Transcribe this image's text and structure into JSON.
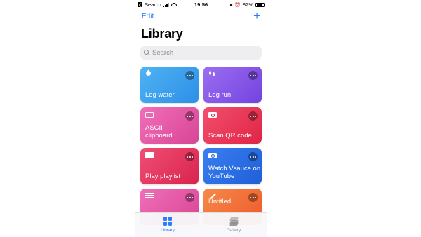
{
  "status_bar": {
    "carrier": "Search",
    "time": "19:56",
    "battery": "82%",
    "battery_level": 0.82
  },
  "nav": {
    "edit_label": "Edit",
    "add_label": "+"
  },
  "page": {
    "title": "Library"
  },
  "search": {
    "placeholder": "Search"
  },
  "shortcuts": [
    {
      "label": "Log water",
      "icon": "water-drop-icon",
      "color": "#2d8fe6"
    },
    {
      "label": "Log run",
      "icon": "footprints-icon",
      "color": "#7443e0"
    },
    {
      "label": "ASCII clipboard",
      "icon": "keyboard-icon",
      "color": "#d94596"
    },
    {
      "label": "Scan QR code",
      "icon": "camera-icon",
      "color": "#e02545"
    },
    {
      "label": "Play playlist",
      "icon": "list-icon",
      "color": "#d8244f"
    },
    {
      "label": "Watch Vsauce on YouTube",
      "icon": "video-icon",
      "color": "#1f5fd8"
    },
    {
      "label": "",
      "icon": "list-icon",
      "color": "#d94596"
    },
    {
      "label": "Untitled",
      "icon": "magic-wand-icon",
      "color": "#ee5a2a"
    }
  ],
  "tabbar": {
    "library_label": "Library",
    "gallery_label": "Gallery",
    "active_color": "#2b7df1",
    "inactive_color": "#8e8e93"
  }
}
